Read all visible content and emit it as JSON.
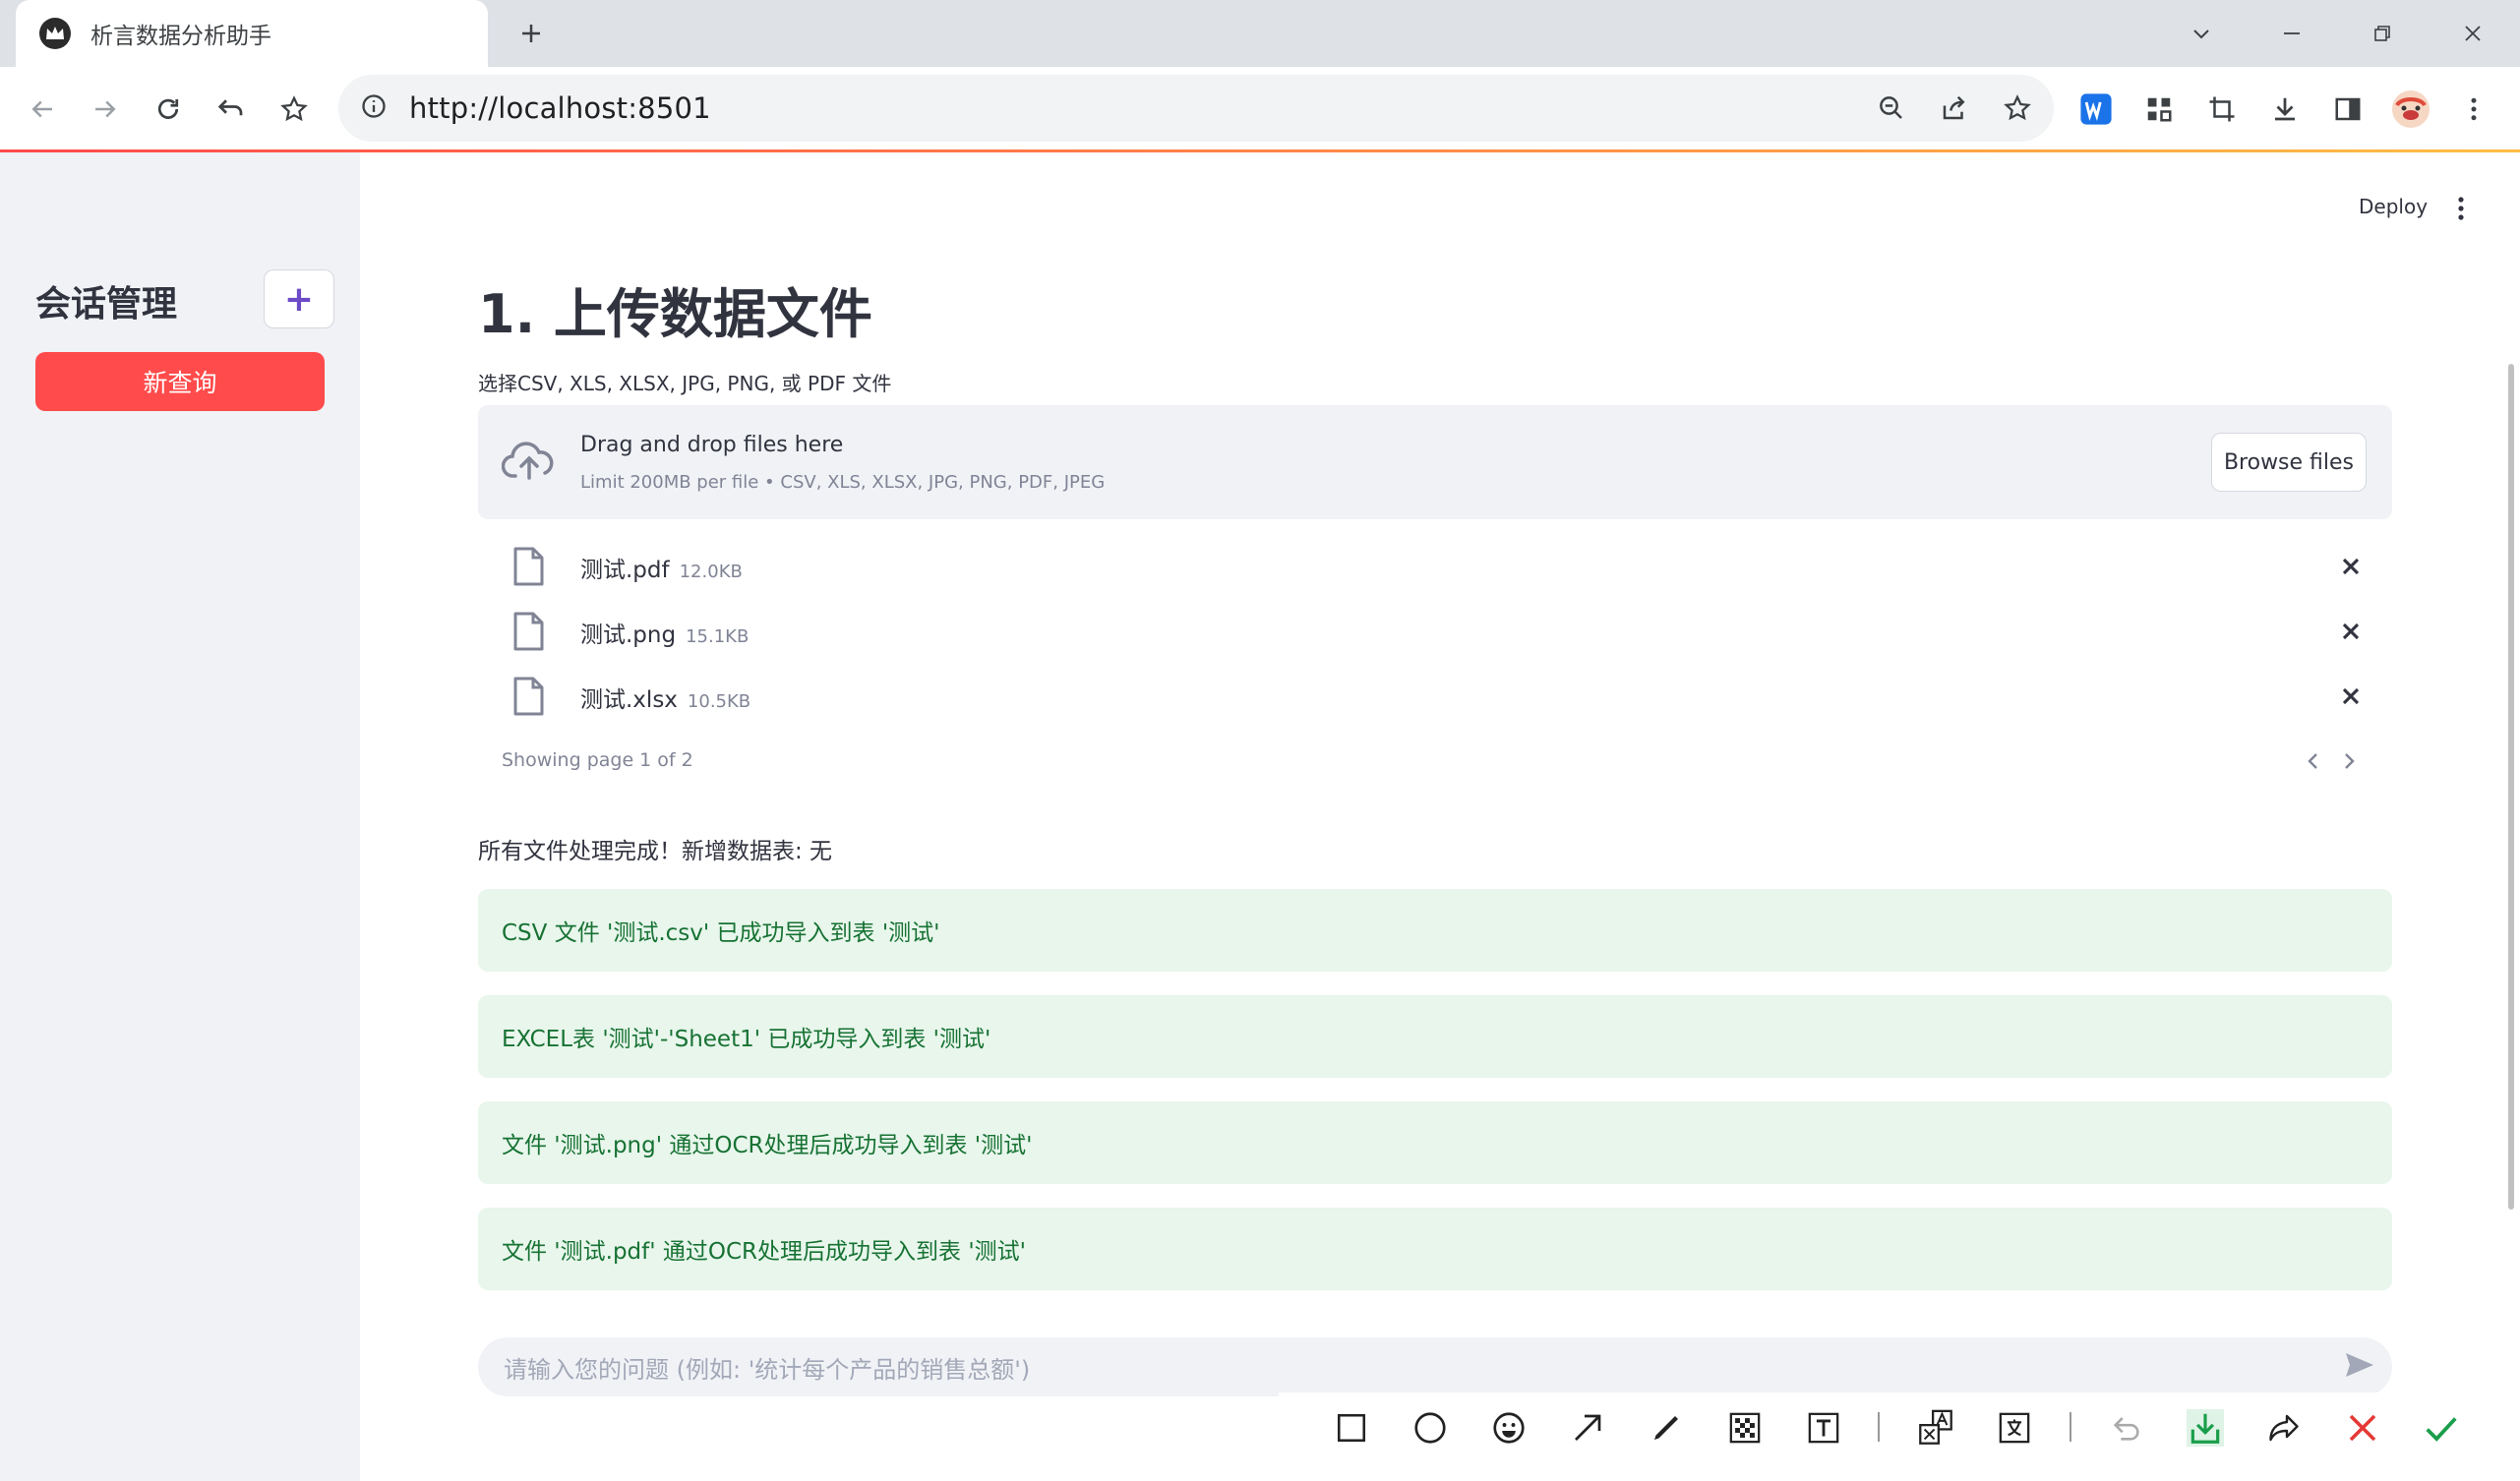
{
  "browser": {
    "tab_title": "析言数据分析助手",
    "url": "http://localhost:8501"
  },
  "sidebar": {
    "title": "会话管理",
    "add_label": "+",
    "new_query_label": "新查询"
  },
  "header": {
    "deploy_label": "Deploy"
  },
  "main": {
    "title": "1. 上传数据文件",
    "uploader_label": "选择CSV, XLS, XLSX, JPG, PNG, 或 PDF 文件",
    "dropzone_title": "Drag and drop files here",
    "dropzone_limit": "Limit 200MB per file • CSV, XLS, XLSX, JPG, PNG, PDF, JPEG",
    "browse_label": "Browse files",
    "files": [
      {
        "name": "测试.pdf",
        "size": "12.0KB"
      },
      {
        "name": "测试.png",
        "size": "15.1KB"
      },
      {
        "name": "测试.xlsx",
        "size": "10.5KB"
      }
    ],
    "pager_text": "Showing page 1 of 2",
    "status_text": "所有文件处理完成！新增数据表: 无",
    "alerts": [
      "CSV 文件 '测试.csv' 已成功导入到表 '测试'",
      "EXCEL表 '测试'-'Sheet1' 已成功导入到表 '测试'",
      "文件 '测试.png' 通过OCR处理后成功导入到表 '测试'",
      "文件 '测试.pdf' 通过OCR处理后成功导入到表 '测试'"
    ],
    "chat_placeholder": "请输入您的问题 (例如: '统计每个产品的销售总额')"
  },
  "colors": {
    "primary": "#ff4b4b",
    "success_bg": "#e8f6ec",
    "success_text": "#177233",
    "sidebar_bg": "#f0f2f6"
  }
}
